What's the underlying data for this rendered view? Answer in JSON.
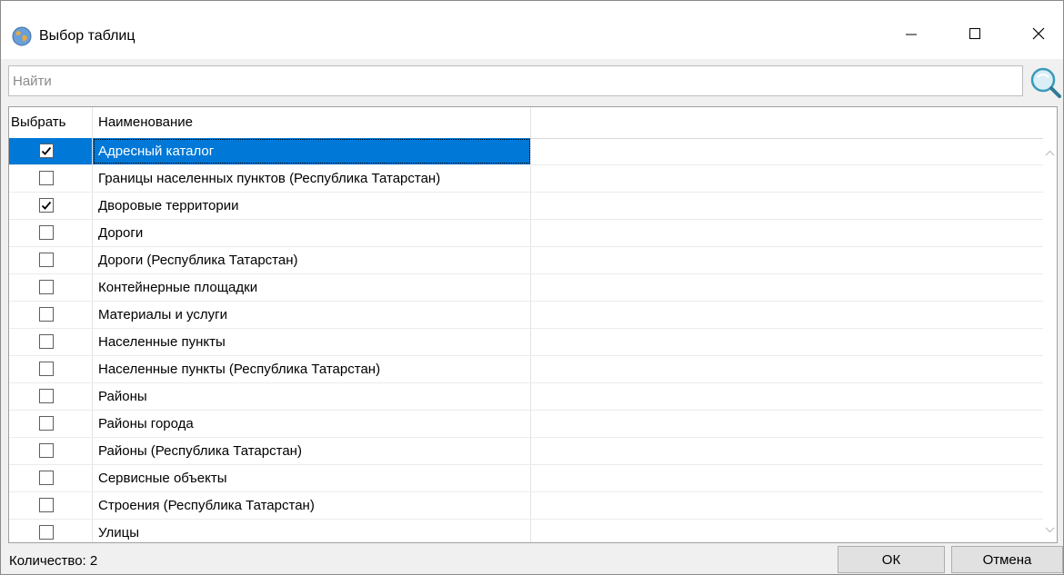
{
  "window": {
    "title": "Выбор таблиц",
    "icon": "globe-icon",
    "controls": [
      "minimize-icon",
      "maximize-icon",
      "close-icon"
    ]
  },
  "search": {
    "placeholder": "Найти",
    "value": "",
    "button_icon": "search-icon"
  },
  "grid": {
    "columns": {
      "select": "Выбрать",
      "name": "Наименование"
    },
    "rows": [
      {
        "checked": true,
        "name": "Адресный каталог",
        "selected": true
      },
      {
        "checked": false,
        "name": "Границы населенных пунктов (Республика Татарстан)"
      },
      {
        "checked": true,
        "name": "Дворовые территории"
      },
      {
        "checked": false,
        "name": "Дороги"
      },
      {
        "checked": false,
        "name": "Дороги (Республика Татарстан)"
      },
      {
        "checked": false,
        "name": "Контейнерные площадки"
      },
      {
        "checked": false,
        "name": "Материалы и услуги"
      },
      {
        "checked": false,
        "name": "Населенные пункты"
      },
      {
        "checked": false,
        "name": "Населенные пункты (Республика Татарстан)"
      },
      {
        "checked": false,
        "name": "Районы"
      },
      {
        "checked": false,
        "name": "Районы города"
      },
      {
        "checked": false,
        "name": "Районы (Республика Татарстан)"
      },
      {
        "checked": false,
        "name": "Сервисные объекты"
      },
      {
        "checked": false,
        "name": "Строения (Республика Татарстан)"
      },
      {
        "checked": false,
        "name": "Улицы"
      }
    ]
  },
  "status": {
    "count": "Количество: 2"
  },
  "buttons": {
    "ok": "ОК",
    "cancel": "Отмена"
  },
  "colors": {
    "selection": "#0078d7",
    "window_bg": "#f0f0f0"
  }
}
